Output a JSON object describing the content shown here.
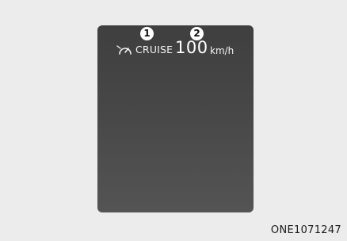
{
  "cluster": {
    "cruise_label": "CRUISE",
    "cruise_icon": "cruise-control-icon",
    "speed_value": "100",
    "speed_unit": "km/h"
  },
  "callouts": {
    "first": "1",
    "second": "2"
  },
  "figure_code": "ONE1071247",
  "colors": {
    "display_background": "#474747",
    "page_background": "#ececec",
    "text": "#ffffff"
  }
}
